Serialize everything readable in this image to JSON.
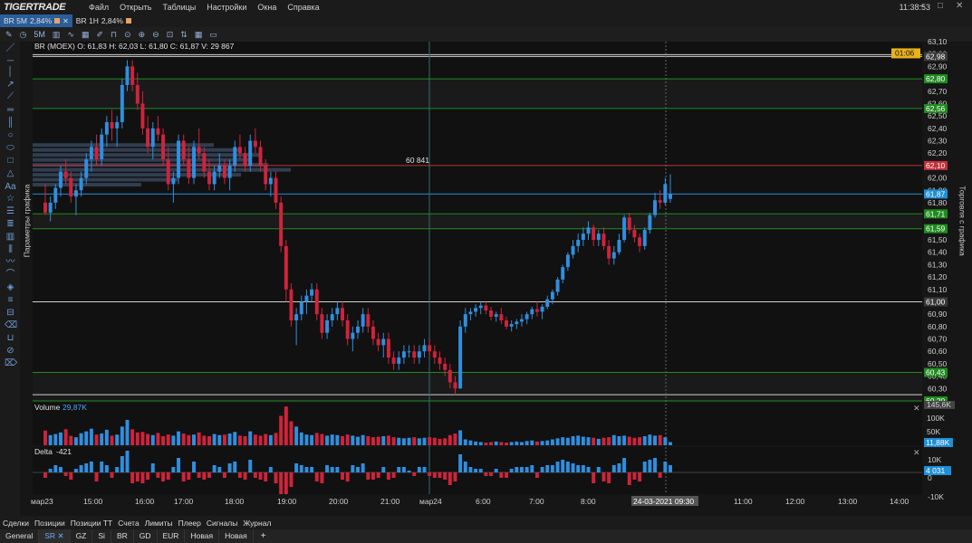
{
  "app": {
    "logo": "TIGERTRADE",
    "menu": [
      "Файл",
      "Открыть",
      "Таблицы",
      "Настройки",
      "Окна",
      "Справка"
    ],
    "clock": "11:38:53"
  },
  "chart_tabs": [
    {
      "label": "BR 5M",
      "change": "2,84%",
      "active": true
    },
    {
      "label": "BR 1H",
      "change": "2,84%",
      "active": false
    }
  ],
  "toolbar": {
    "timeframe": "5M"
  },
  "side_labels": {
    "left": "Параметры графика",
    "right": "Торговля с графика"
  },
  "ohlc_info": "BR (MOEX) O: 61,83  H: 62,03  L: 61,80  C: 61,87  V: 29 867",
  "timer_badge": "01:06",
  "volume_marker": "60 841",
  "price_axis": {
    "ticks": [
      "63,10",
      "63,00",
      "62,90",
      "62,80",
      "62,70",
      "62,60",
      "62,50",
      "62,40",
      "62,30",
      "62,20",
      "62,10",
      "62,00",
      "61,90",
      "61,80",
      "61,70",
      "61,60",
      "61,50",
      "61,40",
      "61,30",
      "61,20",
      "61,10",
      "61,00",
      "60,90",
      "60,80",
      "60,70",
      "60,60",
      "60,50",
      "60,40",
      "60,30",
      "60,20"
    ],
    "level_tags": [
      {
        "label": "62,98",
        "price": 62.98,
        "color": "#3a3a3a"
      },
      {
        "label": "62,80",
        "price": 62.8,
        "color": "#1f8b1f"
      },
      {
        "label": "62,56",
        "price": 62.56,
        "color": "#1f8b1f"
      },
      {
        "label": "62,10",
        "price": 62.1,
        "color": "#c2303a"
      },
      {
        "label": "61,87",
        "price": 61.87,
        "color": "#1e8fd8"
      },
      {
        "label": "61,71",
        "price": 61.71,
        "color": "#1f8b1f"
      },
      {
        "label": "61,59",
        "price": 61.59,
        "color": "#1f8b1f"
      },
      {
        "label": "61,00",
        "price": 61.0,
        "color": "#3a3a3a"
      },
      {
        "label": "60,43",
        "price": 60.43,
        "color": "#1f8b1f"
      },
      {
        "label": "60,20",
        "price": 60.2,
        "color": "#1f8b1f"
      }
    ]
  },
  "volume_panel": {
    "title": "Volume",
    "value": "29,87K",
    "ticks": [
      "145,6K",
      "100K",
      "50K"
    ],
    "current_tag": "11,88K"
  },
  "delta_panel": {
    "title": "Delta",
    "value": "-421",
    "ticks": [
      "10K",
      "0",
      "-10K"
    ],
    "current_tag": "4 031"
  },
  "time_axis": {
    "labels": [
      "мар23",
      "15:00",
      "16:00",
      "17:00",
      "18:00",
      "19:00",
      "20:00",
      "21:00",
      "мар24",
      "6:00",
      "7:00",
      "8:00",
      "11:00",
      "12:00",
      "13:00",
      "14:00"
    ],
    "cursor_label": "24-03-2021 09:30"
  },
  "bottom_tabs": [
    "Сделки",
    "Позиции",
    "Позиции ТТ",
    "Счета",
    "Лимиты",
    "Плеер",
    "Сигналы",
    "Журнал"
  ],
  "sheet_tabs": [
    "General",
    "SR",
    "GZ",
    "Si",
    "BR",
    "GD",
    "EUR",
    "Новая",
    "Новая"
  ],
  "colors": {
    "up": "#2f8fe0",
    "down": "#d0233b",
    "bg": "#111111"
  },
  "chart_data": {
    "type": "candlestick",
    "instrument": "BR (MOEX)",
    "timeframe": "5M",
    "candles": [
      [
        61.8,
        61.95,
        61.7,
        61.72
      ],
      [
        61.72,
        61.85,
        61.65,
        61.8
      ],
      [
        61.8,
        61.95,
        61.75,
        61.92
      ],
      [
        61.92,
        62.1,
        61.85,
        62.05
      ],
      [
        62.05,
        62.15,
        61.95,
        62.0
      ],
      [
        62.0,
        62.05,
        61.8,
        61.85
      ],
      [
        61.85,
        61.95,
        61.7,
        61.9
      ],
      [
        61.9,
        62.05,
        61.85,
        62.0
      ],
      [
        62.0,
        62.2,
        61.95,
        62.15
      ],
      [
        62.15,
        62.3,
        62.05,
        62.25
      ],
      [
        62.25,
        62.35,
        62.1,
        62.15
      ],
      [
        62.15,
        62.4,
        62.1,
        62.35
      ],
      [
        62.35,
        62.5,
        62.25,
        62.45
      ],
      [
        62.45,
        62.55,
        62.3,
        62.4
      ],
      [
        62.4,
        62.5,
        62.25,
        62.45
      ],
      [
        62.45,
        62.8,
        62.4,
        62.75
      ],
      [
        62.75,
        62.95,
        62.7,
        62.9
      ],
      [
        62.9,
        62.95,
        62.7,
        62.75
      ],
      [
        62.75,
        62.85,
        62.55,
        62.6
      ],
      [
        62.6,
        62.7,
        62.35,
        62.4
      ],
      [
        62.4,
        62.5,
        62.2,
        62.25
      ],
      [
        62.25,
        62.45,
        62.15,
        62.4
      ],
      [
        62.4,
        62.5,
        62.3,
        62.35
      ],
      [
        62.35,
        62.4,
        62.1,
        62.15
      ],
      [
        62.15,
        62.25,
        61.9,
        61.95
      ],
      [
        61.95,
        62.05,
        61.8,
        62.0
      ],
      [
        62.0,
        62.35,
        61.95,
        62.3
      ],
      [
        62.3,
        62.35,
        62.1,
        62.15
      ],
      [
        62.15,
        62.25,
        61.95,
        62.0
      ],
      [
        62.0,
        62.3,
        61.95,
        62.25
      ],
      [
        62.25,
        62.4,
        62.15,
        62.2
      ],
      [
        62.2,
        62.25,
        62.0,
        62.05
      ],
      [
        62.05,
        62.15,
        61.9,
        61.95
      ],
      [
        61.95,
        62.1,
        61.9,
        62.05
      ],
      [
        62.05,
        62.2,
        62.0,
        62.1
      ],
      [
        62.1,
        62.15,
        61.95,
        62.0
      ],
      [
        62.0,
        62.15,
        61.9,
        62.1
      ],
      [
        62.1,
        62.3,
        62.05,
        62.25
      ],
      [
        62.25,
        62.35,
        62.15,
        62.2
      ],
      [
        62.2,
        62.25,
        62.05,
        62.1
      ],
      [
        62.1,
        62.35,
        62.05,
        62.3
      ],
      [
        62.3,
        62.4,
        62.2,
        62.25
      ],
      [
        62.25,
        62.3,
        62.05,
        62.1
      ],
      [
        62.1,
        62.15,
        61.9,
        61.95
      ],
      [
        61.95,
        62.05,
        61.85,
        62.0
      ],
      [
        62.0,
        62.05,
        61.75,
        61.8
      ],
      [
        61.8,
        61.85,
        61.4,
        61.45
      ],
      [
        61.45,
        61.5,
        61.0,
        61.1
      ],
      [
        61.1,
        61.15,
        60.8,
        60.85
      ],
      [
        60.85,
        60.95,
        60.65,
        60.9
      ],
      [
        60.9,
        61.05,
        60.85,
        61.0
      ],
      [
        61.0,
        61.1,
        60.9,
        61.05
      ],
      [
        61.05,
        61.15,
        61.0,
        61.1
      ],
      [
        61.1,
        61.15,
        60.85,
        60.9
      ],
      [
        60.9,
        60.95,
        60.7,
        60.75
      ],
      [
        60.75,
        60.9,
        60.7,
        60.85
      ],
      [
        60.85,
        60.95,
        60.8,
        60.9
      ],
      [
        60.9,
        61.0,
        60.85,
        60.95
      ],
      [
        60.95,
        61.0,
        60.8,
        60.85
      ],
      [
        60.85,
        60.9,
        60.65,
        60.7
      ],
      [
        60.7,
        60.8,
        60.6,
        60.75
      ],
      [
        60.75,
        60.85,
        60.7,
        60.8
      ],
      [
        60.8,
        60.95,
        60.75,
        60.9
      ],
      [
        60.9,
        60.95,
        60.75,
        60.8
      ],
      [
        60.8,
        60.85,
        60.65,
        60.7
      ],
      [
        60.7,
        60.75,
        60.6,
        60.65
      ],
      [
        60.65,
        60.75,
        60.55,
        60.7
      ],
      [
        60.7,
        60.75,
        60.5,
        60.55
      ],
      [
        60.55,
        60.6,
        60.45,
        60.5
      ],
      [
        60.5,
        60.6,
        60.45,
        60.55
      ],
      [
        60.55,
        60.65,
        60.5,
        60.6
      ],
      [
        60.6,
        60.65,
        60.55,
        60.6
      ],
      [
        60.6,
        60.65,
        60.5,
        60.55
      ],
      [
        60.55,
        60.65,
        60.5,
        60.6
      ],
      [
        60.6,
        60.7,
        60.55,
        60.65
      ],
      [
        60.65,
        60.7,
        60.55,
        60.6
      ],
      [
        60.6,
        60.65,
        60.5,
        60.55
      ],
      [
        60.55,
        60.6,
        60.45,
        60.5
      ],
      [
        60.5,
        60.55,
        60.4,
        60.45
      ],
      [
        60.45,
        60.5,
        60.3,
        60.35
      ],
      [
        60.35,
        60.4,
        60.25,
        60.3
      ],
      [
        60.3,
        60.85,
        60.3,
        60.8
      ],
      [
        60.8,
        60.95,
        60.75,
        60.9
      ],
      [
        60.9,
        60.95,
        60.85,
        60.92
      ],
      [
        60.92,
        60.98,
        60.88,
        60.95
      ],
      [
        60.95,
        61.0,
        60.9,
        60.97
      ],
      [
        60.97,
        61.0,
        60.9,
        60.93
      ],
      [
        60.93,
        60.96,
        60.85,
        60.88
      ],
      [
        60.88,
        60.92,
        60.84,
        60.9
      ],
      [
        60.9,
        60.95,
        60.82,
        60.85
      ],
      [
        60.85,
        60.88,
        60.78,
        60.8
      ],
      [
        60.8,
        60.85,
        60.76,
        60.82
      ],
      [
        60.82,
        60.86,
        60.78,
        60.84
      ],
      [
        60.84,
        60.9,
        60.8,
        60.86
      ],
      [
        60.86,
        60.92,
        60.82,
        60.9
      ],
      [
        60.9,
        60.96,
        60.86,
        60.94
      ],
      [
        60.94,
        61.0,
        60.88,
        60.92
      ],
      [
        60.92,
        60.98,
        60.86,
        60.96
      ],
      [
        60.96,
        61.05,
        60.94,
        61.02
      ],
      [
        61.02,
        61.1,
        60.98,
        61.08
      ],
      [
        61.08,
        61.2,
        61.05,
        61.18
      ],
      [
        61.18,
        61.3,
        61.15,
        61.28
      ],
      [
        61.28,
        61.4,
        61.25,
        61.38
      ],
      [
        61.38,
        61.5,
        61.35,
        61.45
      ],
      [
        61.45,
        61.55,
        61.4,
        61.5
      ],
      [
        61.5,
        61.6,
        61.45,
        61.55
      ],
      [
        61.55,
        61.65,
        61.5,
        61.6
      ],
      [
        61.6,
        61.62,
        61.45,
        61.5
      ],
      [
        61.5,
        61.58,
        61.45,
        61.55
      ],
      [
        61.55,
        61.6,
        61.42,
        61.45
      ],
      [
        61.45,
        61.5,
        61.3,
        61.35
      ],
      [
        61.35,
        61.45,
        61.3,
        61.4
      ],
      [
        61.4,
        61.55,
        61.38,
        61.5
      ],
      [
        61.5,
        61.7,
        61.48,
        61.68
      ],
      [
        61.68,
        61.72,
        61.55,
        61.58
      ],
      [
        61.58,
        61.62,
        61.48,
        61.52
      ],
      [
        61.52,
        61.55,
        61.4,
        61.45
      ],
      [
        61.45,
        61.6,
        61.42,
        61.58
      ],
      [
        61.58,
        61.72,
        61.55,
        61.7
      ],
      [
        61.7,
        61.88,
        61.68,
        61.82
      ],
      [
        61.82,
        61.9,
        61.75,
        61.8
      ],
      [
        61.8,
        62.0,
        61.78,
        61.95
      ],
      [
        61.83,
        62.03,
        61.8,
        61.87
      ]
    ],
    "volume": [
      55,
      38,
      42,
      48,
      60,
      35,
      30,
      45,
      52,
      62,
      40,
      44,
      58,
      36,
      40,
      70,
      95,
      60,
      48,
      50,
      42,
      38,
      46,
      34,
      40,
      36,
      52,
      44,
      38,
      40,
      48,
      36,
      34,
      42,
      38,
      40,
      44,
      50,
      36,
      34,
      52,
      40,
      36,
      42,
      38,
      46,
      110,
      145,
      90,
      70,
      48,
      40,
      38,
      46,
      42,
      36,
      40,
      38,
      34,
      40,
      36,
      32,
      38,
      34,
      30,
      32,
      34,
      36,
      30,
      28,
      26,
      28,
      30,
      26,
      28,
      30,
      28,
      24,
      26,
      38,
      44,
      56,
      22,
      18,
      14,
      12,
      10,
      12,
      14,
      12,
      10,
      12,
      14,
      12,
      16,
      18,
      14,
      16,
      18,
      22,
      26,
      30,
      28,
      34,
      36,
      32,
      30,
      28,
      24,
      28,
      30,
      38,
      34,
      36,
      32,
      28,
      30,
      34,
      40,
      36,
      38,
      30,
      12
    ],
    "delta": [
      -3,
      2,
      4,
      3,
      -2,
      -4,
      2,
      4,
      5,
      6,
      -5,
      6,
      4,
      -3,
      3,
      9,
      12,
      -6,
      -5,
      -6,
      -4,
      5,
      -3,
      -5,
      -4,
      3,
      8,
      -5,
      -4,
      6,
      -3,
      -4,
      -3,
      4,
      3,
      -3,
      5,
      6,
      -3,
      -4,
      7,
      -3,
      -4,
      -5,
      3,
      -6,
      -12,
      -14,
      -8,
      5,
      4,
      3,
      3,
      -5,
      -6,
      4,
      3,
      3,
      -4,
      -5,
      4,
      3,
      5,
      -4,
      -4,
      -3,
      3,
      -4,
      -3,
      3,
      3,
      1,
      -2,
      3,
      3,
      -2,
      -3,
      -3,
      -4,
      -7,
      -5,
      10,
      6,
      3,
      2,
      2,
      -2,
      -2,
      2,
      -3,
      -3,
      2,
      3,
      3,
      3,
      4,
      -3,
      3,
      4,
      4,
      6,
      7,
      6,
      5,
      4,
      4,
      3,
      -6,
      3,
      -5,
      -6,
      4,
      5,
      8,
      -7,
      -4,
      -5,
      6,
      7,
      8,
      -3,
      6,
      4
    ],
    "ylim": [
      60.2,
      63.1
    ],
    "volume_ylim": [
      0,
      145.6
    ],
    "delta_ylim": [
      -12,
      14
    ]
  }
}
